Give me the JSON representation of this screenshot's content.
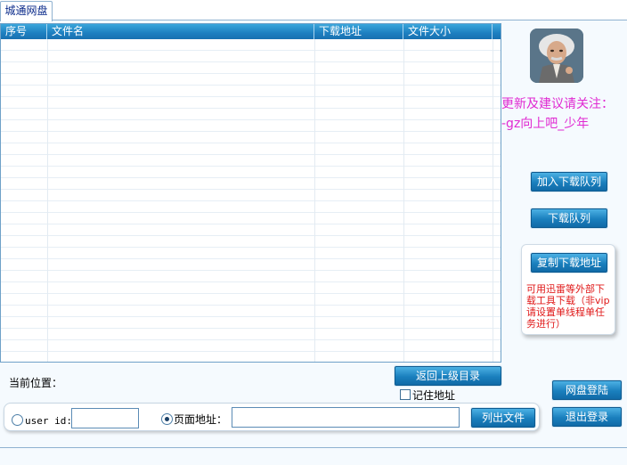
{
  "tab": {
    "label": "城通网盘"
  },
  "list": {
    "columns": [
      "序号",
      "文件名",
      "下载地址",
      "文件大小"
    ],
    "rows": []
  },
  "promo": {
    "line1": "更新及建议请关注：",
    "line2": "-gz向上吧_少年"
  },
  "buttons": {
    "add_queue": "加入下载队列",
    "download_queue": "下载队列",
    "copy_link": "复制下载地址",
    "back_up": "返回上级目录",
    "list_files": "列出文件",
    "login": "网盘登陆",
    "logout": "退出登录"
  },
  "note": "可用迅雷等外部下载工具下载（非vip请设置单线程单任务进行）",
  "location": {
    "label": "当前位置：",
    "value": ""
  },
  "remember": {
    "label": "记住地址",
    "checked": false
  },
  "input_mode": {
    "userid_label": "user id:",
    "userid_value": "",
    "userid_selected": false,
    "page_label": "页面地址：",
    "page_value": "",
    "page_selected": true
  },
  "colors": {
    "accent": "#1a7fbd",
    "promo": "#e02ad2",
    "note": "#e01818"
  }
}
